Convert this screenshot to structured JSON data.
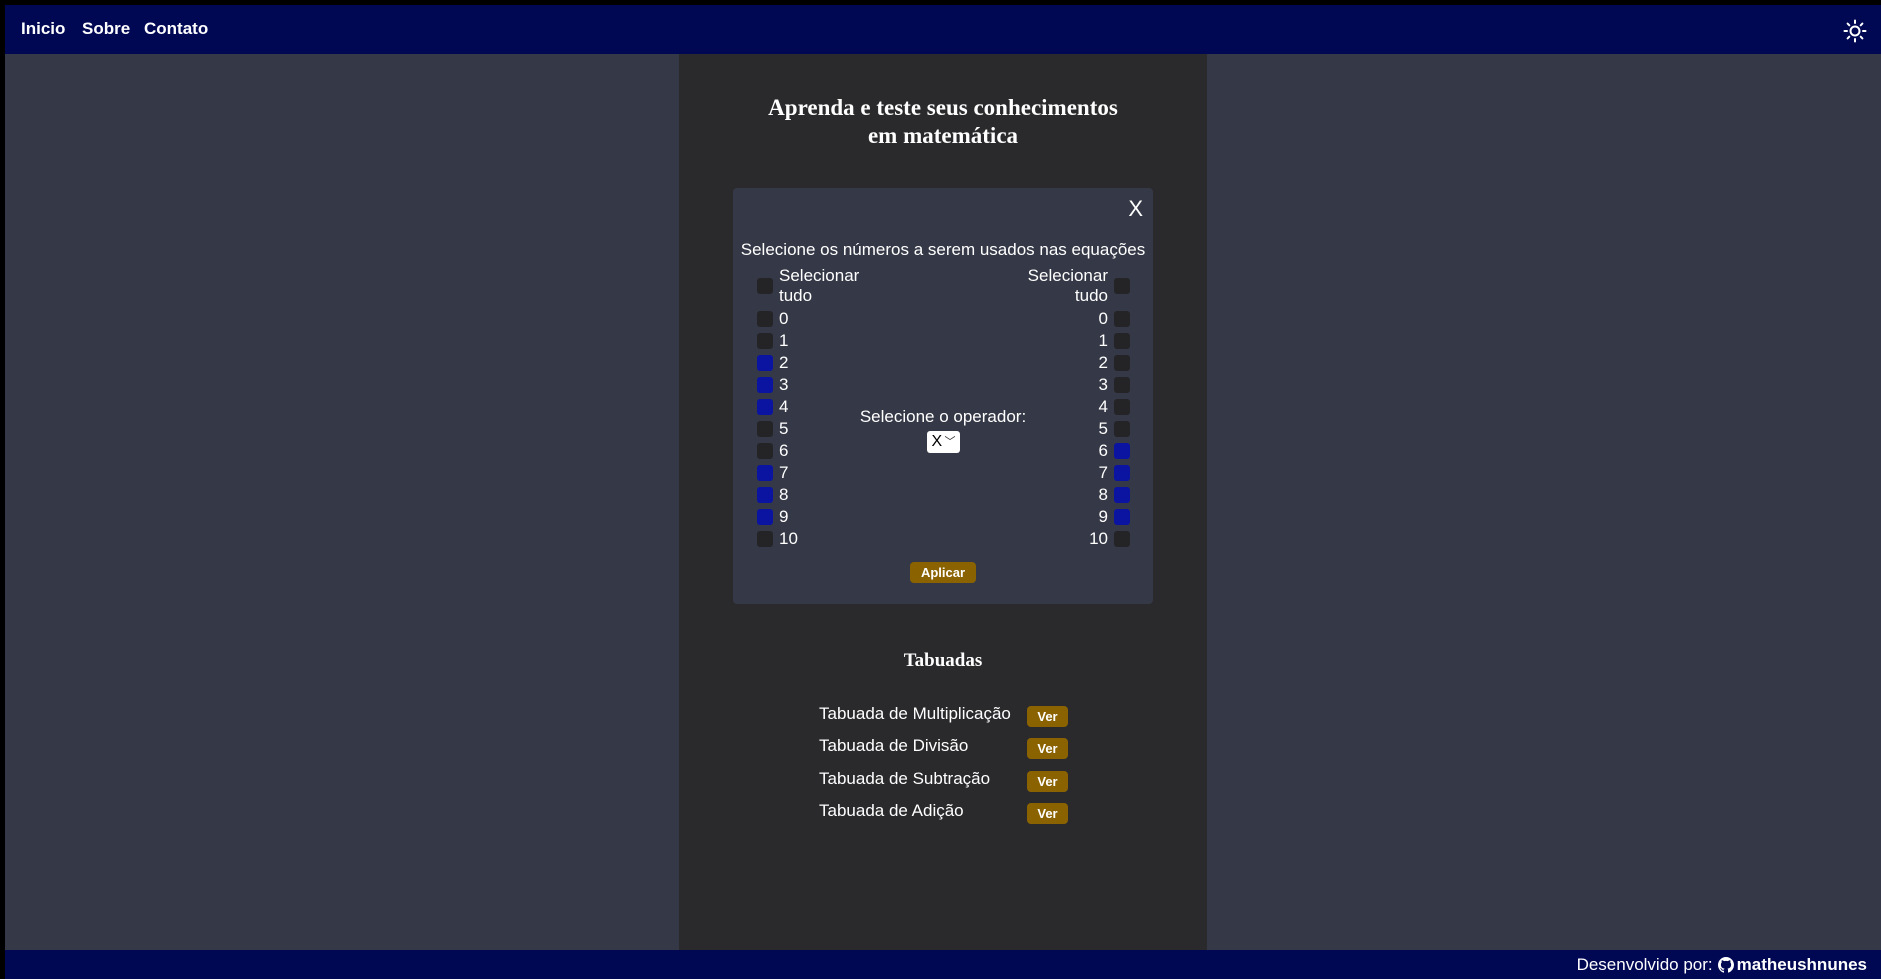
{
  "nav": {
    "items": [
      "Inicio",
      "Sobre",
      "Contato"
    ],
    "theme_icon": "sun-icon"
  },
  "page": {
    "title_line1": "Aprenda e teste seus conhecimentos",
    "title_line2": "em matemática"
  },
  "modal": {
    "close_label": "X",
    "instruction": "Selecione os números a serem usados nas equações",
    "select_all_label": "Selecionar tudo",
    "operator_label": "Selecione o operador:",
    "operator_value": "X",
    "apply_label": "Aplicar",
    "left_numbers": [
      {
        "n": "0",
        "checked": false
      },
      {
        "n": "1",
        "checked": false
      },
      {
        "n": "2",
        "checked": true
      },
      {
        "n": "3",
        "checked": true
      },
      {
        "n": "4",
        "checked": true
      },
      {
        "n": "5",
        "checked": false
      },
      {
        "n": "6",
        "checked": false
      },
      {
        "n": "7",
        "checked": true
      },
      {
        "n": "8",
        "checked": true
      },
      {
        "n": "9",
        "checked": true
      },
      {
        "n": "10",
        "checked": false
      }
    ],
    "right_numbers": [
      {
        "n": "0",
        "checked": false
      },
      {
        "n": "1",
        "checked": false
      },
      {
        "n": "2",
        "checked": false
      },
      {
        "n": "3",
        "checked": false
      },
      {
        "n": "4",
        "checked": false
      },
      {
        "n": "5",
        "checked": false
      },
      {
        "n": "6",
        "checked": true
      },
      {
        "n": "7",
        "checked": true
      },
      {
        "n": "8",
        "checked": true
      },
      {
        "n": "9",
        "checked": true
      },
      {
        "n": "10",
        "checked": false
      }
    ]
  },
  "tabuadas": {
    "title": "Tabuadas",
    "items": [
      {
        "label": "Tabuada de Multiplicação",
        "button": "Ver"
      },
      {
        "label": "Tabuada de Divisão",
        "button": "Ver"
      },
      {
        "label": "Tabuada de Subtração",
        "button": "Ver"
      },
      {
        "label": "Tabuada de Adição",
        "button": "Ver"
      }
    ]
  },
  "footer": {
    "text": "Desenvolvido por:",
    "author": "matheushnunes",
    "icon": "github-icon"
  },
  "colors": {
    "navbar": "#000854",
    "background": "#353846",
    "main": "#2a2a2c",
    "accent_button": "#8a6300",
    "checked": "#0a14a0"
  }
}
